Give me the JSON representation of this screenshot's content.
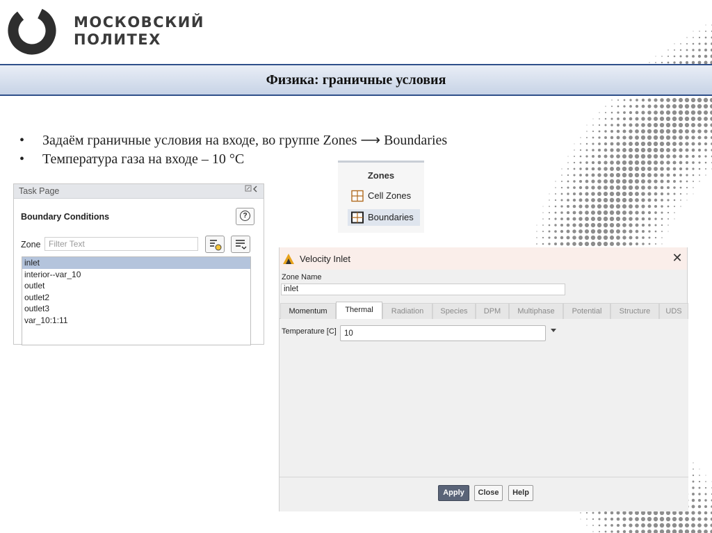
{
  "brand": {
    "line1": "МОСКОВСКИЙ",
    "line2": "ПОЛИТЕХ"
  },
  "slide": {
    "title": "Физика: граничные условия",
    "bullets": [
      "Задаём граничные условия на входе, во группе Zones ⟶ Boundaries",
      "Температура газа на входе – 10 °C"
    ]
  },
  "task_page": {
    "header": "Task Page",
    "section": "Boundary Conditions",
    "help_symbol": "?",
    "zone_label": "Zone",
    "filter_placeholder": "Filter Text",
    "zones": [
      "inlet",
      "interior--var_10",
      "outlet",
      "outlet2",
      "outlet3",
      "var_10:1:11"
    ],
    "selected_zone": "inlet"
  },
  "ribbon": {
    "group": "Zones",
    "items": [
      "Cell Zones",
      "Boundaries"
    ],
    "active": "Boundaries"
  },
  "dialog": {
    "title": "Velocity Inlet",
    "close_symbol": "✕",
    "zone_name_label": "Zone Name",
    "zone_name_value": "inlet",
    "tabs": [
      "Momentum",
      "Thermal",
      "Radiation",
      "Species",
      "DPM",
      "Multiphase",
      "Potential",
      "Structure",
      "UDS"
    ],
    "active_tab": "Thermal",
    "temperature_label": "Temperature [C]",
    "temperature_value": "10",
    "buttons": {
      "apply": "Apply",
      "close": "Close",
      "help": "Help"
    }
  },
  "colors": {
    "title_band_border": "#2e4f8a",
    "selection": "#b4c4dc",
    "apply_button": "#5a6478",
    "dialog_header": "#faeeea"
  }
}
